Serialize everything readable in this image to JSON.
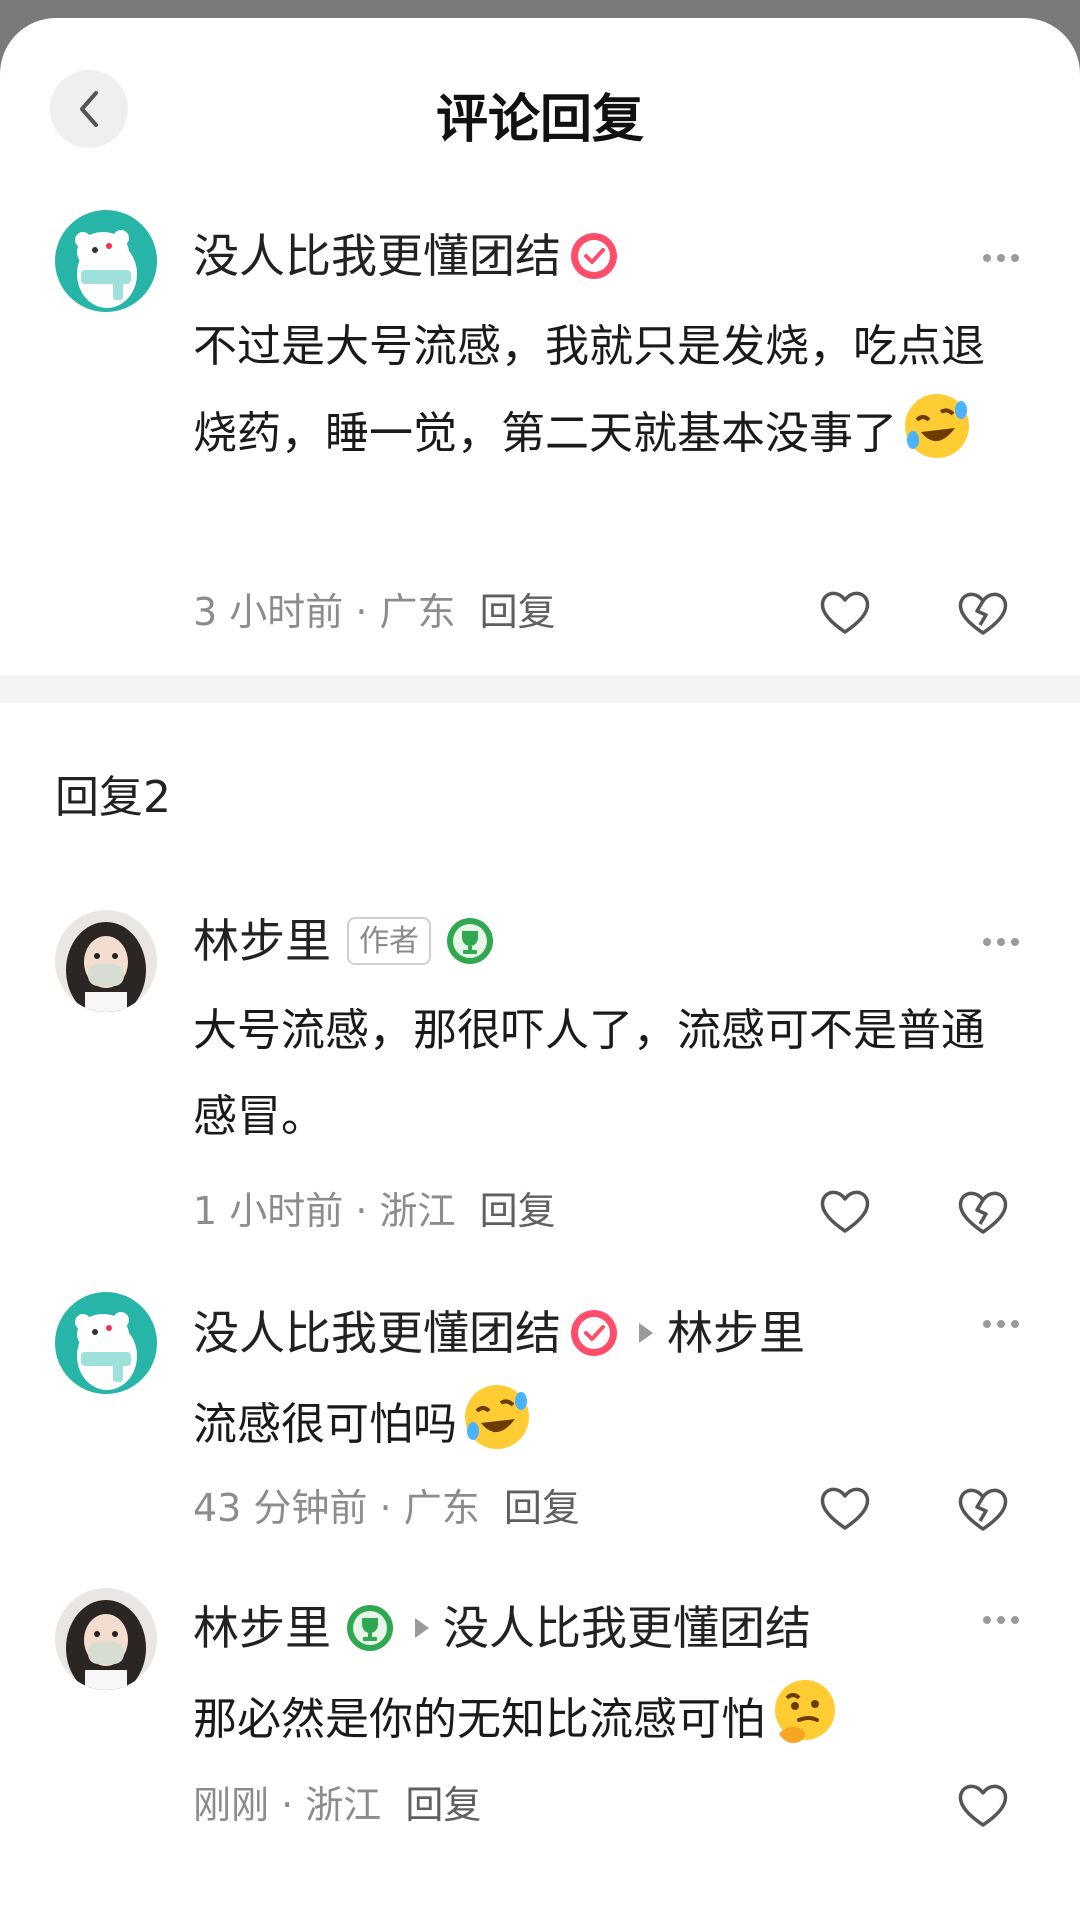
{
  "header": {
    "title": "评论回复"
  },
  "main_comment": {
    "user": "没人比我更懂团结",
    "text": "不过是大号流感，我就只是发烧，吃点退烧药，睡一觉，第二天就基本没事了",
    "emoji": "rofl-emoji",
    "time": "3 小时前",
    "location": "广东",
    "reply_label": "回复"
  },
  "section": {
    "title": "回复2"
  },
  "replies": [
    {
      "user": "林步里",
      "badge": "作者",
      "text": "大号流感，那很吓人了，流感可不是普通感冒。",
      "time": "1 小时前",
      "location": "浙江",
      "reply_label": "回复"
    },
    {
      "user": "没人比我更懂团结",
      "reply_to": "林步里",
      "text": "流感很可怕吗",
      "emoji": "rofl-emoji",
      "time": "43 分钟前",
      "location": "广东",
      "reply_label": "回复"
    },
    {
      "user": "林步里",
      "reply_to": "没人比我更懂团结",
      "text": "那必然是你的无知比流感可怕",
      "emoji": "thinking-emoji",
      "time": "刚刚",
      "location": "浙江",
      "reply_label": "回复"
    }
  ],
  "meta_separator": "·",
  "colors": {
    "verified": "#ff4d6a",
    "trophy": "#2fa84f",
    "avatar_teal": "#26b5a6",
    "meta_gray": "#8c8c8c"
  }
}
